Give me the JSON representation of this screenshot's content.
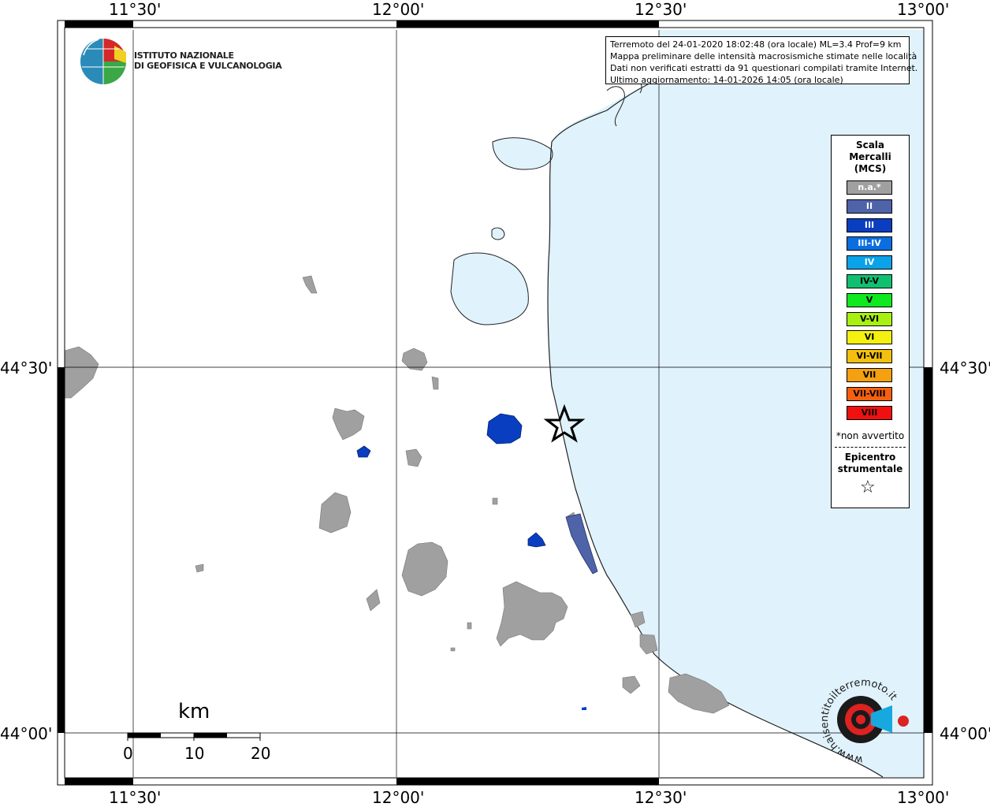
{
  "map": {
    "lon_ticks": [
      "11°30'",
      "12°00'",
      "12°30'",
      "13°00'"
    ],
    "lat_ticks": [
      "44°30'",
      "44°00'"
    ]
  },
  "info_box": {
    "lines": [
      "Terremoto del 24-01-2020 18:02:48 (ora locale) ML=3.4 Prof=9 km",
      "Mappa preliminare delle intensità macrosismiche stimate nelle località",
      "Dati non verificati estratti da 91 questionari compilati tramite Internet.",
      "Ultimo aggiornamento: 14-01-2026 14:05 (ora locale)"
    ]
  },
  "logo": {
    "line1": "ISTITUTO NAZIONALE",
    "line2": "DI GEOFISICA E VULCANOLOGIA"
  },
  "legend": {
    "title_lines": [
      "Scala",
      "Mercalli",
      "(MCS)"
    ],
    "items": [
      {
        "label": "n.a.*",
        "color": "#a0a0a0",
        "text_color": "#ffffff"
      },
      {
        "label": "II",
        "color": "#4f63a9",
        "text_color": "#ffffff"
      },
      {
        "label": "III",
        "color": "#0a3ec0",
        "text_color": "#ffffff"
      },
      {
        "label": "III-IV",
        "color": "#0a6ee0",
        "text_color": "#ffffff"
      },
      {
        "label": "IV",
        "color": "#0aa2e8",
        "text_color": "#ffffff"
      },
      {
        "label": "IV-V",
        "color": "#10c070",
        "text_color": "#000000"
      },
      {
        "label": "V",
        "color": "#10e820",
        "text_color": "#000000"
      },
      {
        "label": "V-VI",
        "color": "#a8f010",
        "text_color": "#000000"
      },
      {
        "label": "VI",
        "color": "#f4f010",
        "text_color": "#000000"
      },
      {
        "label": "VI-VII",
        "color": "#f4c010",
        "text_color": "#000000"
      },
      {
        "label": "VII",
        "color": "#f4a010",
        "text_color": "#000000"
      },
      {
        "label": "VII-VIII",
        "color": "#f46010",
        "text_color": "#000000"
      },
      {
        "label": "VIII",
        "color": "#f01010",
        "text_color": "#000000"
      }
    ],
    "note": "*non avvertito",
    "epicenter_lines": [
      "Epicentro",
      "strumentale"
    ],
    "epicenter_symbol": "☆"
  },
  "scale_bar": {
    "unit": "km",
    "labels": [
      "0",
      "10",
      "20"
    ]
  },
  "colors": {
    "sea": "#e0f2fc",
    "land": "#ffffff",
    "urban": "#a0a0a0",
    "intensity_II": "#4f63a9",
    "intensity_III": "#0a3ec0"
  },
  "haisentito_logo": {
    "text": "www.haisentitoilterremoto.it"
  }
}
